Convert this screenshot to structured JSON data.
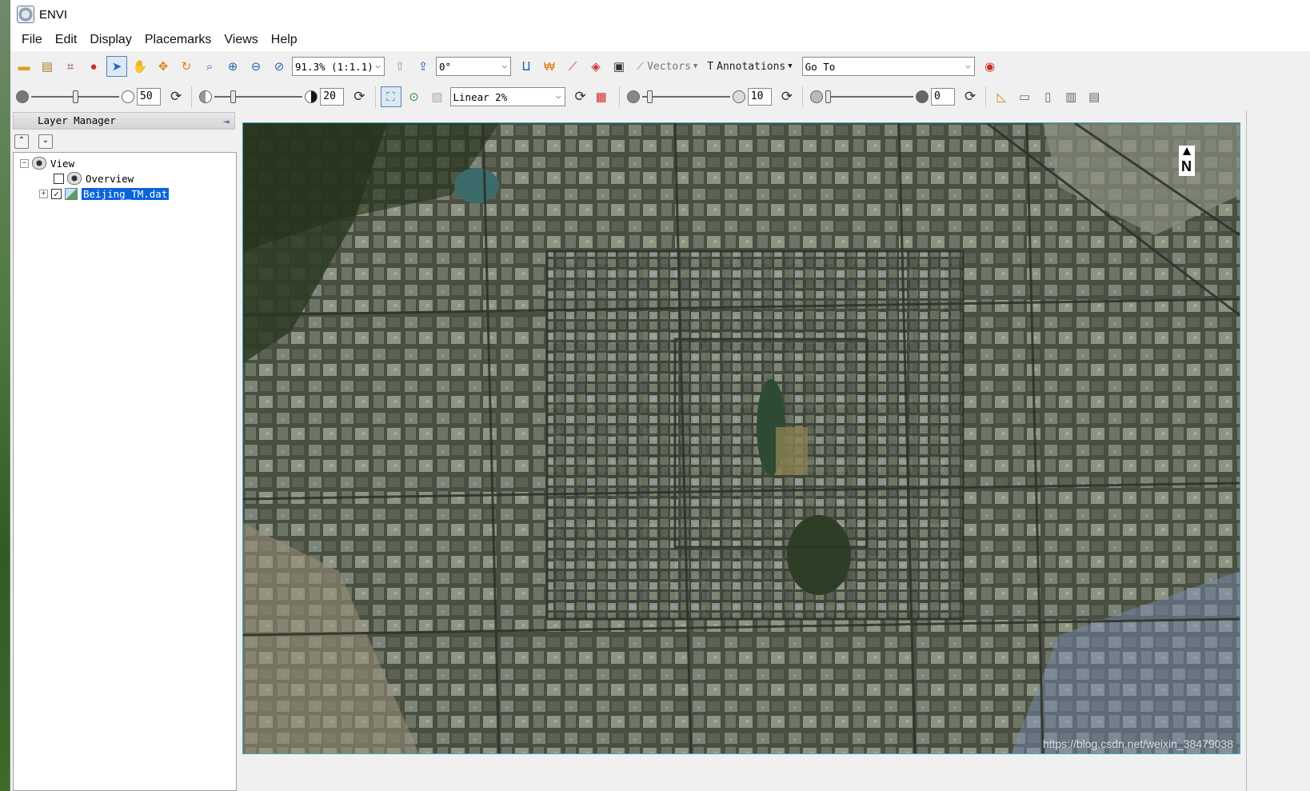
{
  "window": {
    "title": "ENVI"
  },
  "menu": [
    "File",
    "Edit",
    "Display",
    "Placemarks",
    "Views",
    "Help"
  ],
  "toolbar1": {
    "zoom_value": "91.3% (1:1.1)",
    "rotation_value": "0°",
    "vectors_label": "Vectors",
    "annotations_label": "Annotations",
    "goto_value": "Go To"
  },
  "toolbar2": {
    "brightness_value": "50",
    "contrast_value": "20",
    "stretch_value": "Linear 2%",
    "sharpen_value": "10",
    "transparency_value": "0"
  },
  "layer_manager": {
    "title": "Layer Manager",
    "tree": {
      "view_label": "View",
      "overview_label": "Overview",
      "layer_label": "Beijing_TM.dat"
    }
  },
  "image": {
    "description_colors": [
      "#2c3128",
      "#8f9682",
      "#6e8fc4"
    ]
  },
  "watermark": "https://blog.csdn.net/weixin_38479038"
}
